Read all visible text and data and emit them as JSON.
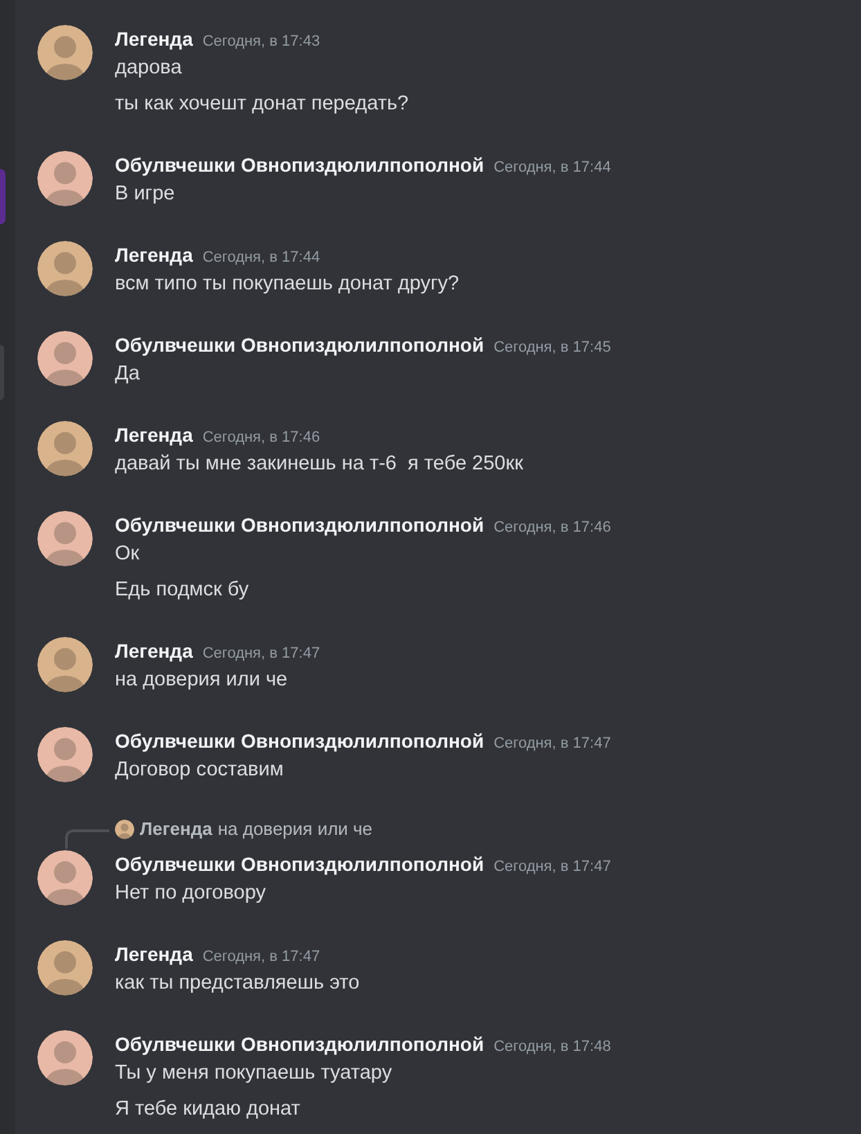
{
  "messages": [
    {
      "author": "Легенда",
      "time": "Сегодня, в 17:43",
      "color": "#d9b38c",
      "lines": [
        "дарова",
        "ты как хочешт донат передать?"
      ]
    },
    {
      "author": "Обулвчешки Овнопиздюлилпополной",
      "time": "Сегодня, в 17:44",
      "color": "#e7b9a6",
      "lines": [
        "В игре"
      ]
    },
    {
      "author": "Легенда",
      "time": "Сегодня, в 17:44",
      "color": "#d9b38c",
      "lines": [
        "всм типо ты покупаешь донат другу?"
      ]
    },
    {
      "author": "Обулвчешки Овнопиздюлилпополной",
      "time": "Сегодня, в 17:45",
      "color": "#e7b9a6",
      "lines": [
        "Да"
      ]
    },
    {
      "author": "Легенда",
      "time": "Сегодня, в 17:46",
      "color": "#d9b38c",
      "lines": [
        "давай ты мне закинешь на т-6  я тебе 250кк"
      ]
    },
    {
      "author": "Обулвчешки Овнопиздюлилпополной",
      "time": "Сегодня, в 17:46",
      "color": "#e7b9a6",
      "lines": [
        "Ок",
        "Едь подмск бу"
      ]
    },
    {
      "author": "Легенда",
      "time": "Сегодня, в 17:47",
      "color": "#d9b38c",
      "lines": [
        "на доверия или че"
      ]
    },
    {
      "author": "Обулвчешки Овнопиздюлилпополной",
      "time": "Сегодня, в 17:47",
      "color": "#e7b9a6",
      "lines": [
        "Договор составим"
      ]
    },
    {
      "author": "Обулвчешки Овнопиздюлилпополной",
      "time": "Сегодня, в 17:47",
      "color": "#e7b9a6",
      "reply": {
        "author": "Легенда",
        "text": "на доверия или че",
        "color": "#d9b38c"
      },
      "lines": [
        "Нет по договору"
      ]
    },
    {
      "author": "Легенда",
      "time": "Сегодня, в 17:47",
      "color": "#d9b38c",
      "lines": [
        "как ты представляешь это"
      ]
    },
    {
      "author": "Обулвчешки Овнопиздюлилпополной",
      "time": "Сегодня, в 17:48",
      "color": "#e7b9a6",
      "lines": [
        "Ты у меня покупаешь туатару",
        "Я тебе кидаю донат"
      ]
    }
  ]
}
